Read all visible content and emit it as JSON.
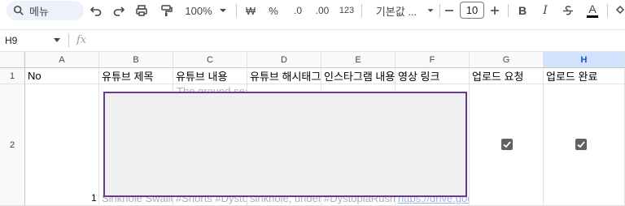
{
  "toolbar": {
    "menu_search_label": "메뉴",
    "zoom": "100%",
    "currency": "₩",
    "percent": "%",
    "decrease_decimal": ".0",
    "increase_decimal": ".00",
    "number_format": "123",
    "font_name": "기본값 ...",
    "font_size": "10",
    "bold": "B",
    "italic": "I",
    "text_color": "A"
  },
  "formula_bar": {
    "name_box": "H9",
    "fx": "fx"
  },
  "columns": [
    "A",
    "B",
    "C",
    "D",
    "E",
    "F",
    "G",
    "H"
  ],
  "rows": [
    "1",
    "2"
  ],
  "row1": {
    "a": "No",
    "b": "유튜브 제목",
    "c": "유튜브 내용",
    "d": "유튜브 해시태그",
    "e": "인스타그램 내용",
    "f": "영상 링크",
    "g": "업로드 요청",
    "h": "업로드 완료"
  },
  "row2": {
    "no": "1",
    "c_top": "The ground sear",
    "b_bottom": "Sinkhole Swallow",
    "c_bottom": "#Shorts #Dystop",
    "d_bottom": "sinkhole, underg",
    "e_bottom": "#DystopiaRush #",
    "f_link": "https://drive.goo",
    "upload_request_checked": true,
    "upload_done_checked": true
  },
  "icons": [
    "search-icon",
    "undo-icon",
    "redo-icon",
    "print-icon",
    "paint-format-icon",
    "strikethrough-icon",
    "fill-color-icon",
    "checkbox-checked-icon"
  ],
  "colors": {
    "selected_header_bg": "#d3e3fd",
    "selected_header_text": "#0b57d0",
    "redaction_border": "#6a3b8c",
    "redaction_fill": "#efefef"
  }
}
